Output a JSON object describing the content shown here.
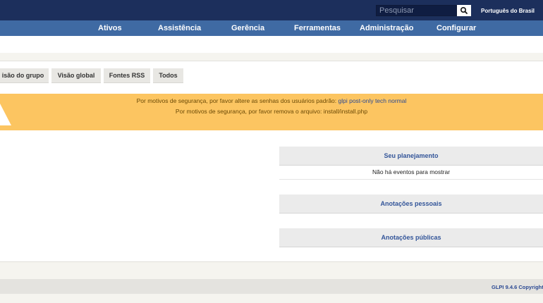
{
  "header": {
    "search_placeholder": "Pesquisar",
    "language": "Português do Brasil"
  },
  "menu": {
    "items": [
      "Ativos",
      "Assistência",
      "Gerência",
      "Ferramentas",
      "Administração",
      "Configurar"
    ]
  },
  "tabs": [
    "isão do grupo",
    "Visão global",
    "Fontes RSS",
    "Todos"
  ],
  "warnings": {
    "line1_text": "Por motivos de segurança, por favor altere as senhas dos usuários padrão: ",
    "line1_link": "glpi post-only tech normal",
    "line2_text": "Por motivos de segurança, por favor remova o arquivo: install/install.php"
  },
  "panels": {
    "planning_title": "Seu planejamento",
    "planning_empty": "Não há eventos para mostrar",
    "personal_notes": "Anotações pessoais",
    "public_notes": "Anotações públicas"
  },
  "footer": {
    "version": "GLPI 9.4.6 Copyright"
  },
  "colors": {
    "topbar": "#1c2f5c",
    "menubar": "#3f6aa3",
    "warning": "#fcc561",
    "link": "#335599"
  },
  "icons": {
    "search": "search-icon",
    "warning": "warning-icon"
  }
}
